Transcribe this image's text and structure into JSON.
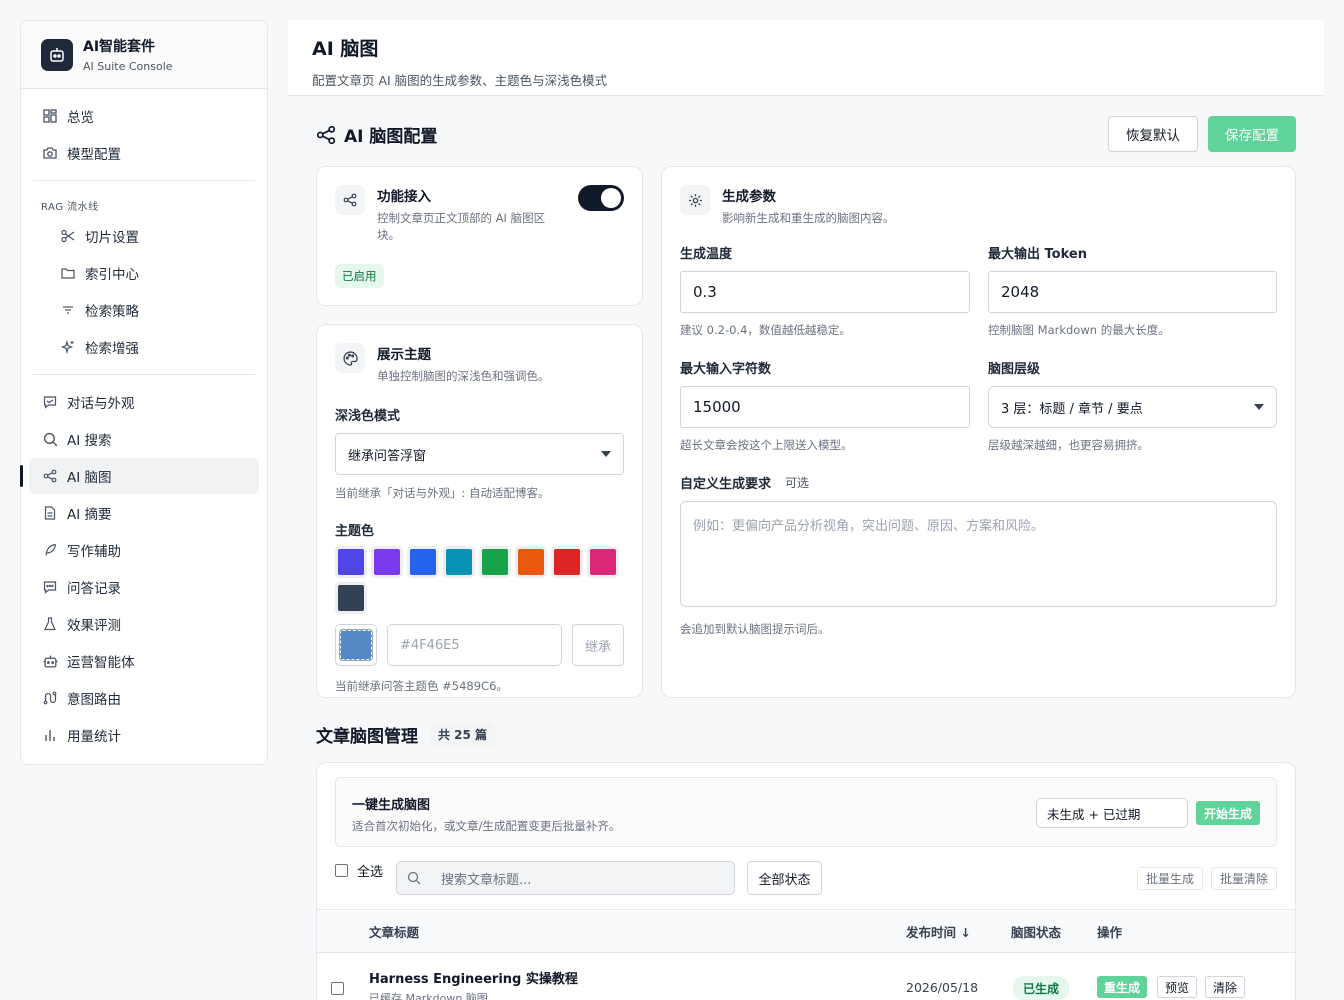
{
  "brand": {
    "title": "AI智能套件",
    "subtitle": "AI Suite Console"
  },
  "nav": {
    "overview": "总览",
    "model_config": "模型配置",
    "rag_section": "RAG 流水线",
    "chunk_settings": "切片设置",
    "index_center": "索引中心",
    "retrieval_strategy": "检索策略",
    "retrieval_boost": "检索增强",
    "chat_appearance": "对话与外观",
    "ai_search": "AI 搜索",
    "ai_mindmap": "AI 脑图",
    "ai_summary": "AI 摘要",
    "writing_assist": "写作辅助",
    "qa_records": "问答记录",
    "evaluation": "效果评测",
    "ops_intel": "运营智能体",
    "intent_routing": "意图路由",
    "usage_stats": "用量统计"
  },
  "header": {
    "title": "AI 脑图",
    "desc": "配置文章页 AI 脑图的生成参数、主题色与深浅色模式"
  },
  "section": {
    "title": "AI 脑图配置",
    "reset_label": "恢复默认",
    "save_label": "保存配置"
  },
  "feature_card": {
    "title": "功能接入",
    "desc": "控制文章页正文顶部的 AI 脑图区块。",
    "status": "已启用"
  },
  "theme_card": {
    "title": "展示主题",
    "desc": "单独控制脑图的深浅色和强调色。",
    "mode_label": "深浅色模式",
    "mode_value": "继承问答浮窗",
    "mode_hint": "当前继承「对话与外观」: 自动适配博客。",
    "color_label": "主题色",
    "swatches": [
      "#4f46e5",
      "#7c3aed",
      "#2563eb",
      "#0891b2",
      "#16a34a",
      "#ea580c",
      "#dc2626",
      "#db2777",
      "#334155"
    ],
    "current_color": "#5489C6",
    "color_placeholder": "#4F46E5",
    "inherit_label": "继承",
    "color_hint": "当前继承问答主题色 #5489C6。"
  },
  "params_card": {
    "title": "生成参数",
    "desc": "影响新生成和重生成的脑图内容。",
    "temp_label": "生成温度",
    "temp_value": "0.3",
    "temp_hint": "建议 0.2-0.4，数值越低越稳定。",
    "token_label": "最大输出 Token",
    "token_value": "2048",
    "token_hint": "控制脑图 Markdown 的最大长度。",
    "input_label": "最大输入字符数",
    "input_value": "15000",
    "input_hint": "超长文章会按这个上限送入模型。",
    "level_label": "脑图层级",
    "level_value": "3 层：标题 / 章节 / 要点",
    "level_hint": "层级越深越细，也更容易拥挤。",
    "custom_label": "自定义生成要求",
    "custom_optional": "可选",
    "custom_placeholder": "例如：更偏向产品分析视角，突出问题、原因、方案和风险。",
    "custom_hint": "会追加到默认脑图提示词后。"
  },
  "manage": {
    "title": "文章脑图管理",
    "count": "共 25 篇",
    "bulk_title": "一键生成脑图",
    "bulk_desc": "适合首次初始化，或文章/生成配置变更后批量补齐。",
    "bulk_scope": "未生成 + 已过期",
    "bulk_start": "开始生成",
    "select_all": "全选",
    "search_placeholder": "搜索文章标题...",
    "status_filter": "全部状态",
    "batch_generate": "批量生成",
    "batch_clear": "批量清除",
    "columns": {
      "title": "文章标题",
      "date": "发布时间 ↓",
      "status": "脑图状态",
      "ops": "操作"
    },
    "rows": [
      {
        "title": "Harness Engineering 实操教程",
        "sub": "已缓存 Markdown 脑图",
        "date": "2026/05/18",
        "status": "已生成",
        "regen": "重生成",
        "preview": "预览",
        "clear": "清除"
      }
    ]
  }
}
